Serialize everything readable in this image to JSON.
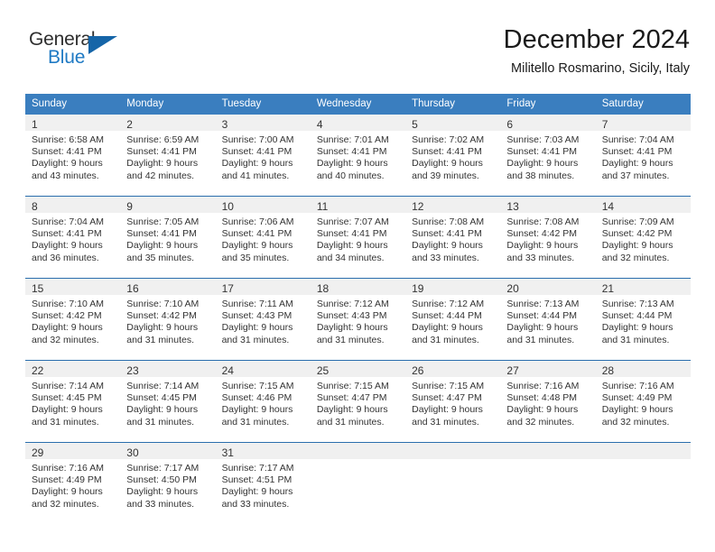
{
  "brand": {
    "name_top": "General",
    "name_bottom": "Blue",
    "logo_icon": "triangle-logo-icon",
    "accent_color": "#1f7ac4"
  },
  "header": {
    "title": "December 2024",
    "subtitle": "Militello Rosmarino, Sicily, Italy"
  },
  "theme": {
    "header_bg": "#3a7ebf",
    "row_divider": "#2a6ead",
    "daynum_bg": "#f0f0f0",
    "text": "#333333"
  },
  "weekday_headers": [
    "Sunday",
    "Monday",
    "Tuesday",
    "Wednesday",
    "Thursday",
    "Friday",
    "Saturday"
  ],
  "weeks": [
    [
      {
        "day": "1",
        "sunrise": "Sunrise: 6:58 AM",
        "sunset": "Sunset: 4:41 PM",
        "daylight1": "Daylight: 9 hours",
        "daylight2": "and 43 minutes."
      },
      {
        "day": "2",
        "sunrise": "Sunrise: 6:59 AM",
        "sunset": "Sunset: 4:41 PM",
        "daylight1": "Daylight: 9 hours",
        "daylight2": "and 42 minutes."
      },
      {
        "day": "3",
        "sunrise": "Sunrise: 7:00 AM",
        "sunset": "Sunset: 4:41 PM",
        "daylight1": "Daylight: 9 hours",
        "daylight2": "and 41 minutes."
      },
      {
        "day": "4",
        "sunrise": "Sunrise: 7:01 AM",
        "sunset": "Sunset: 4:41 PM",
        "daylight1": "Daylight: 9 hours",
        "daylight2": "and 40 minutes."
      },
      {
        "day": "5",
        "sunrise": "Sunrise: 7:02 AM",
        "sunset": "Sunset: 4:41 PM",
        "daylight1": "Daylight: 9 hours",
        "daylight2": "and 39 minutes."
      },
      {
        "day": "6",
        "sunrise": "Sunrise: 7:03 AM",
        "sunset": "Sunset: 4:41 PM",
        "daylight1": "Daylight: 9 hours",
        "daylight2": "and 38 minutes."
      },
      {
        "day": "7",
        "sunrise": "Sunrise: 7:04 AM",
        "sunset": "Sunset: 4:41 PM",
        "daylight1": "Daylight: 9 hours",
        "daylight2": "and 37 minutes."
      }
    ],
    [
      {
        "day": "8",
        "sunrise": "Sunrise: 7:04 AM",
        "sunset": "Sunset: 4:41 PM",
        "daylight1": "Daylight: 9 hours",
        "daylight2": "and 36 minutes."
      },
      {
        "day": "9",
        "sunrise": "Sunrise: 7:05 AM",
        "sunset": "Sunset: 4:41 PM",
        "daylight1": "Daylight: 9 hours",
        "daylight2": "and 35 minutes."
      },
      {
        "day": "10",
        "sunrise": "Sunrise: 7:06 AM",
        "sunset": "Sunset: 4:41 PM",
        "daylight1": "Daylight: 9 hours",
        "daylight2": "and 35 minutes."
      },
      {
        "day": "11",
        "sunrise": "Sunrise: 7:07 AM",
        "sunset": "Sunset: 4:41 PM",
        "daylight1": "Daylight: 9 hours",
        "daylight2": "and 34 minutes."
      },
      {
        "day": "12",
        "sunrise": "Sunrise: 7:08 AM",
        "sunset": "Sunset: 4:41 PM",
        "daylight1": "Daylight: 9 hours",
        "daylight2": "and 33 minutes."
      },
      {
        "day": "13",
        "sunrise": "Sunrise: 7:08 AM",
        "sunset": "Sunset: 4:42 PM",
        "daylight1": "Daylight: 9 hours",
        "daylight2": "and 33 minutes."
      },
      {
        "day": "14",
        "sunrise": "Sunrise: 7:09 AM",
        "sunset": "Sunset: 4:42 PM",
        "daylight1": "Daylight: 9 hours",
        "daylight2": "and 32 minutes."
      }
    ],
    [
      {
        "day": "15",
        "sunrise": "Sunrise: 7:10 AM",
        "sunset": "Sunset: 4:42 PM",
        "daylight1": "Daylight: 9 hours",
        "daylight2": "and 32 minutes."
      },
      {
        "day": "16",
        "sunrise": "Sunrise: 7:10 AM",
        "sunset": "Sunset: 4:42 PM",
        "daylight1": "Daylight: 9 hours",
        "daylight2": "and 31 minutes."
      },
      {
        "day": "17",
        "sunrise": "Sunrise: 7:11 AM",
        "sunset": "Sunset: 4:43 PM",
        "daylight1": "Daylight: 9 hours",
        "daylight2": "and 31 minutes."
      },
      {
        "day": "18",
        "sunrise": "Sunrise: 7:12 AM",
        "sunset": "Sunset: 4:43 PM",
        "daylight1": "Daylight: 9 hours",
        "daylight2": "and 31 minutes."
      },
      {
        "day": "19",
        "sunrise": "Sunrise: 7:12 AM",
        "sunset": "Sunset: 4:44 PM",
        "daylight1": "Daylight: 9 hours",
        "daylight2": "and 31 minutes."
      },
      {
        "day": "20",
        "sunrise": "Sunrise: 7:13 AM",
        "sunset": "Sunset: 4:44 PM",
        "daylight1": "Daylight: 9 hours",
        "daylight2": "and 31 minutes."
      },
      {
        "day": "21",
        "sunrise": "Sunrise: 7:13 AM",
        "sunset": "Sunset: 4:44 PM",
        "daylight1": "Daylight: 9 hours",
        "daylight2": "and 31 minutes."
      }
    ],
    [
      {
        "day": "22",
        "sunrise": "Sunrise: 7:14 AM",
        "sunset": "Sunset: 4:45 PM",
        "daylight1": "Daylight: 9 hours",
        "daylight2": "and 31 minutes."
      },
      {
        "day": "23",
        "sunrise": "Sunrise: 7:14 AM",
        "sunset": "Sunset: 4:45 PM",
        "daylight1": "Daylight: 9 hours",
        "daylight2": "and 31 minutes."
      },
      {
        "day": "24",
        "sunrise": "Sunrise: 7:15 AM",
        "sunset": "Sunset: 4:46 PM",
        "daylight1": "Daylight: 9 hours",
        "daylight2": "and 31 minutes."
      },
      {
        "day": "25",
        "sunrise": "Sunrise: 7:15 AM",
        "sunset": "Sunset: 4:47 PM",
        "daylight1": "Daylight: 9 hours",
        "daylight2": "and 31 minutes."
      },
      {
        "day": "26",
        "sunrise": "Sunrise: 7:15 AM",
        "sunset": "Sunset: 4:47 PM",
        "daylight1": "Daylight: 9 hours",
        "daylight2": "and 31 minutes."
      },
      {
        "day": "27",
        "sunrise": "Sunrise: 7:16 AM",
        "sunset": "Sunset: 4:48 PM",
        "daylight1": "Daylight: 9 hours",
        "daylight2": "and 32 minutes."
      },
      {
        "day": "28",
        "sunrise": "Sunrise: 7:16 AM",
        "sunset": "Sunset: 4:49 PM",
        "daylight1": "Daylight: 9 hours",
        "daylight2": "and 32 minutes."
      }
    ],
    [
      {
        "day": "29",
        "sunrise": "Sunrise: 7:16 AM",
        "sunset": "Sunset: 4:49 PM",
        "daylight1": "Daylight: 9 hours",
        "daylight2": "and 32 minutes."
      },
      {
        "day": "30",
        "sunrise": "Sunrise: 7:17 AM",
        "sunset": "Sunset: 4:50 PM",
        "daylight1": "Daylight: 9 hours",
        "daylight2": "and 33 minutes."
      },
      {
        "day": "31",
        "sunrise": "Sunrise: 7:17 AM",
        "sunset": "Sunset: 4:51 PM",
        "daylight1": "Daylight: 9 hours",
        "daylight2": "and 33 minutes."
      },
      {
        "day": "",
        "sunrise": "",
        "sunset": "",
        "daylight1": "",
        "daylight2": ""
      },
      {
        "day": "",
        "sunrise": "",
        "sunset": "",
        "daylight1": "",
        "daylight2": ""
      },
      {
        "day": "",
        "sunrise": "",
        "sunset": "",
        "daylight1": "",
        "daylight2": ""
      },
      {
        "day": "",
        "sunrise": "",
        "sunset": "",
        "daylight1": "",
        "daylight2": ""
      }
    ]
  ]
}
